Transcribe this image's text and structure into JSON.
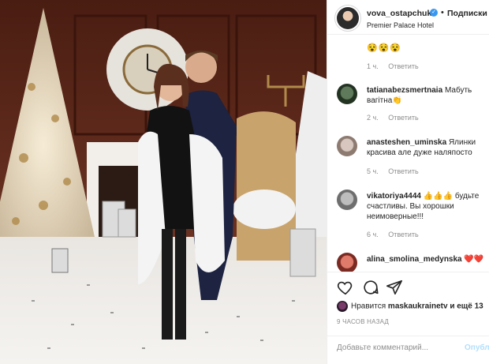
{
  "post": {
    "image_alt": "Couple posing in front of decorated Christmas tree and clock"
  },
  "header": {
    "username": "vova_ostapchuk",
    "separator": "•",
    "follow_label": "Подписки",
    "location": "Premier Palace Hotel",
    "verified_mark": "✓"
  },
  "top_comment": {
    "emoji": "😵😵😵",
    "time": "1 ч.",
    "reply_label": "Ответить"
  },
  "comments": [
    {
      "username": "tatianabezsmertnaia",
      "text": "Мабуть вагітна👏",
      "time": "2 ч.",
      "reply_label": "Ответить",
      "avatar_color": "#3b4a3c"
    },
    {
      "username": "anasteshen_uminska",
      "text": "Ялинки красива але дуже наляпосто",
      "time": "5 ч.",
      "reply_label": "Ответить",
      "avatar_color": "#b9a8a0"
    },
    {
      "username": "vikatoriya4444",
      "text": "👍👍👍 будьте счастливы. Вы хорошки неимоверные!!!",
      "time": "6 ч.",
      "reply_label": "Ответить",
      "avatar_color": "#8c8c8c"
    },
    {
      "username": "alina_smolina_medynska",
      "text": "❤️❤️",
      "time": "",
      "reply_label": "",
      "avatar_color": "#c0392b"
    }
  ],
  "actions": {
    "liked_by_prefix": "Нравится",
    "liked_by_user": "maskaukrainetv",
    "liked_by_suffix": "и ещё 13",
    "time_ago": "9 ЧАСОВ НАЗАД"
  },
  "composer": {
    "placeholder": "Добавьте комментарий...",
    "publish_label": "Опубл"
  },
  "colors": {
    "link_blue": "#3897f0",
    "muted_text": "#8e8e8e",
    "publish_disabled": "#b2dffc"
  }
}
